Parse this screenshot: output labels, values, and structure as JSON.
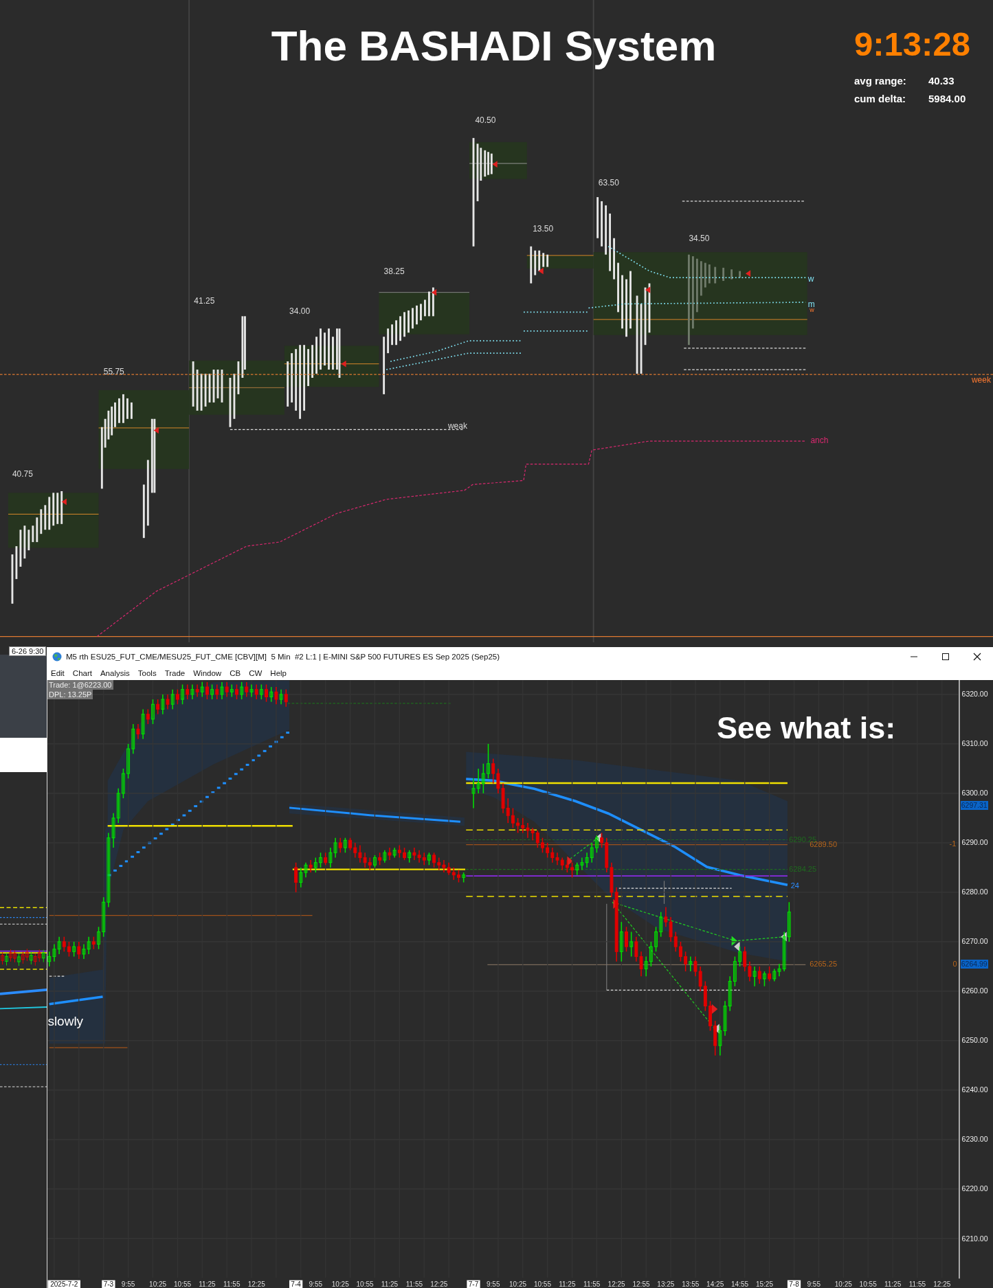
{
  "profile_chart": {
    "title": "The BASHADI System",
    "clock": "9:13:28",
    "stats": [
      {
        "label": "avg range:",
        "value": "40.33"
      },
      {
        "label": "cum delta:",
        "value": "5984.00"
      }
    ],
    "range_labels": [
      "40.50",
      "63.50",
      "13.50",
      "34.50",
      "38.25",
      "41.25",
      "34.00",
      "55.75",
      "40.75"
    ],
    "line_labels": [
      {
        "text": "w",
        "kind": "vwap"
      },
      {
        "text": "m",
        "kind": "vwap"
      },
      {
        "text": "w",
        "kind": "minor"
      },
      {
        "text": "week",
        "kind": "week"
      },
      {
        "text": "weak",
        "kind": "level"
      },
      {
        "text": "anch",
        "kind": "anchor"
      }
    ]
  },
  "left_panel": {
    "time_tab": "6-26 9:30"
  },
  "chart_window": {
    "title": "M5 rth ESU25_FUT_CME/MESU25_FUT_CME [CBV][M]  5 Min  #2 L:1 | E-MINI S&P 500 FUTURES ES Sep 2025 (Sep25)",
    "menu": [
      "Edit",
      "Chart",
      "Analysis",
      "Tools",
      "Trade",
      "Window",
      "CB",
      "CW",
      "Help"
    ],
    "trade_info": [
      "Trade: 1@6223.00",
      "DPL: 13.25P"
    ],
    "overlay_texts": [
      "See what is:",
      "slowly"
    ],
    "price_markers": [
      "6297.31",
      "6264.99"
    ],
    "axis_labels": [
      {
        "kind": "date"
      },
      {
        "kind": "date"
      },
      {
        "kind": "time"
      },
      {
        "kind": "time"
      },
      {
        "kind": "time"
      },
      {
        "kind": "time"
      },
      {
        "kind": "time"
      },
      {
        "kind": "time"
      },
      {
        "kind": "date"
      },
      {
        "kind": "time"
      },
      {
        "kind": "time"
      },
      {
        "kind": "time"
      },
      {
        "kind": "time"
      },
      {
        "kind": "time"
      },
      {
        "kind": "time"
      },
      {
        "kind": "date"
      },
      {
        "kind": "time"
      },
      {
        "kind": "time"
      },
      {
        "kind": "time"
      },
      {
        "kind": "time"
      },
      {
        "kind": "time"
      },
      {
        "kind": "time"
      },
      {
        "kind": "time"
      },
      {
        "kind": "time"
      },
      {
        "kind": "time"
      },
      {
        "kind": "time"
      },
      {
        "kind": "time"
      },
      {
        "kind": "time"
      },
      {
        "kind": "date"
      },
      {
        "kind": "time"
      },
      {
        "kind": "time"
      },
      {
        "kind": "time"
      },
      {
        "kind": "time"
      },
      {
        "kind": "time"
      },
      {
        "kind": "time"
      }
    ],
    "level_labels": [
      {
        "text": "6290.25",
        "color": "#1e6b1e"
      },
      {
        "text": "6289.50",
        "color": "#b8651a"
      },
      {
        "text": "6284.25",
        "color": "#1e6b1e"
      },
      {
        "text": "24",
        "color": "#2b8cff"
      },
      {
        "text": "6265.25",
        "color": "#b8651a"
      },
      {
        "text": "-1",
        "color": "#b8651a"
      },
      {
        "text": "0",
        "color": "#b8651a"
      }
    ],
    "chart_data": {
      "type": "candlestick",
      "grid": true,
      "ylim": [
        6201.9,
        6322.9
      ],
      "yticks": [
        {
          "value": 6320,
          "label": "6320.00"
        },
        {
          "value": 6310,
          "label": "6310.00"
        },
        {
          "value": 6300,
          "label": "6300.00"
        },
        {
          "value": 6290,
          "label": "6290.00"
        },
        {
          "value": 6280,
          "label": "6280.00"
        },
        {
          "value": 6270,
          "label": "6270.00"
        },
        {
          "value": 6260,
          "label": "6260.00"
        },
        {
          "value": 6250,
          "label": "6250.00"
        },
        {
          "value": 6240,
          "label": "6240.00"
        },
        {
          "value": 6230,
          "label": "6230.00"
        },
        {
          "value": 6220,
          "label": "6220.00"
        },
        {
          "value": 6210,
          "label": "6210.00"
        }
      ],
      "categories": [
        null,
        null,
        null,
        "2025-7-2",
        null,
        null,
        null,
        null,
        null,
        null,
        null,
        null,
        "7-3",
        null,
        null,
        null,
        "9:55",
        null,
        null,
        null,
        null,
        null,
        "10:25",
        null,
        null,
        null,
        null,
        "10:55",
        null,
        null,
        null,
        null,
        "11:25",
        null,
        null,
        null,
        null,
        "11:55",
        null,
        null,
        null,
        null,
        "12:25",
        null,
        null,
        null,
        null,
        null,
        null,
        null,
        "7-4",
        null,
        null,
        null,
        "9:55",
        null,
        null,
        null,
        null,
        "10:25",
        null,
        null,
        null,
        null,
        "10:55",
        null,
        null,
        null,
        null,
        "11:25",
        null,
        null,
        null,
        null,
        "11:55",
        null,
        null,
        null,
        null,
        "12:25",
        null,
        null,
        null,
        null,
        null,
        null,
        "7-7",
        null,
        null,
        null,
        "9:55",
        null,
        null,
        null,
        null,
        "10:25",
        null,
        null,
        null,
        null,
        "10:55",
        null,
        null,
        null,
        null,
        "11:25",
        null,
        null,
        null,
        null,
        "11:55",
        null,
        null,
        null,
        null,
        "12:25",
        null,
        null,
        null,
        null,
        "12:55",
        null,
        null,
        null,
        null,
        "13:25",
        null,
        null,
        null,
        null,
        "13:55",
        null,
        null,
        null,
        null,
        "14:25",
        null,
        null,
        null,
        null,
        "14:55",
        null,
        null,
        null,
        null,
        "15:25",
        null,
        null,
        null,
        null,
        null,
        "7-8",
        null,
        null,
        null,
        "9:55",
        null,
        null,
        null,
        null,
        null,
        "10:25",
        null,
        null,
        null,
        null,
        "10:55",
        null,
        null,
        null,
        null,
        "11:25",
        null,
        null,
        null,
        null,
        "11:55",
        null,
        null,
        null,
        null,
        "12:25"
      ],
      "ohlc": [
        [
          6266,
          6268,
          6265,
          6267
        ],
        [
          6267,
          6269.5,
          6266,
          6268.5
        ],
        [
          6268.5,
          6271,
          6267.5,
          6270
        ],
        [
          6270,
          6271,
          6268,
          6269
        ],
        [
          6269,
          6270,
          6267,
          6268
        ],
        [
          6268,
          6270,
          6267,
          6269
        ],
        [
          6269,
          6270,
          6266.5,
          6267.5
        ],
        [
          6267.5,
          6269.5,
          6266.5,
          6268.5
        ],
        [
          6268.5,
          6271,
          6267.5,
          6270
        ],
        [
          6270,
          6271,
          6268.5,
          6269.5
        ],
        [
          6269.5,
          6273,
          6268.5,
          6272
        ],
        [
          6272,
          6279,
          6271,
          6278
        ],
        [
          6278,
          6292,
          6277,
          6291
        ],
        [
          6291,
          6296,
          6289,
          6295
        ],
        [
          6295,
          6301,
          6294,
          6300
        ],
        [
          6300,
          6305,
          6299,
          6304
        ],
        [
          6304,
          6310,
          6303,
          6309
        ],
        [
          6309,
          6314,
          6308,
          6313
        ],
        [
          6313,
          6314,
          6311,
          6312
        ],
        [
          6312,
          6317,
          6311,
          6316
        ],
        [
          6316,
          6317,
          6314,
          6315
        ],
        [
          6315,
          6319,
          6314,
          6318
        ],
        [
          6318,
          6319,
          6316,
          6317
        ],
        [
          6317,
          6320,
          6316,
          6319
        ],
        [
          6319,
          6320,
          6317,
          6318
        ],
        [
          6318,
          6321,
          6317,
          6320
        ],
        [
          6320,
          6321,
          6318,
          6319
        ],
        [
          6319,
          6322,
          6318,
          6321
        ],
        [
          6321,
          6322,
          6319,
          6320
        ],
        [
          6320,
          6322,
          6319,
          6321
        ],
        [
          6321,
          6322,
          6319.5,
          6320.5
        ],
        [
          6320.5,
          6322.5,
          6319.5,
          6321.5
        ],
        [
          6321.5,
          6322.5,
          6319,
          6320
        ],
        [
          6320,
          6322,
          6319,
          6321
        ],
        [
          6321,
          6322,
          6319,
          6320
        ],
        [
          6320,
          6322.5,
          6319,
          6321.5
        ],
        [
          6321.5,
          6322.5,
          6319.5,
          6320.5
        ],
        [
          6320.5,
          6322,
          6319.5,
          6321
        ],
        [
          6321,
          6322,
          6319,
          6320
        ],
        [
          6320,
          6322.5,
          6319,
          6321.5
        ],
        [
          6321.5,
          6322.5,
          6319.5,
          6320.5
        ],
        [
          6320.5,
          6322,
          6319.5,
          6321
        ],
        [
          6321,
          6322,
          6319,
          6320
        ],
        [
          6320,
          6322,
          6319,
          6321
        ],
        [
          6321,
          6322,
          6318.5,
          6319.5
        ],
        [
          6319.5,
          6321.5,
          6318.5,
          6320.5
        ],
        [
          6320.5,
          6321.5,
          6318,
          6319
        ],
        [
          6319,
          6321,
          6318,
          6320
        ],
        [
          6320,
          6321,
          6317.5,
          6318.5
        ],
        null,
        [
          6285,
          6286,
          6280,
          6282
        ],
        [
          6282,
          6285,
          6281,
          6284
        ],
        [
          6284,
          6286,
          6283,
          6285.5
        ],
        [
          6285.5,
          6286.5,
          6284,
          6285
        ],
        [
          6285,
          6287,
          6284,
          6286
        ],
        [
          6286,
          6288,
          6285,
          6287
        ],
        [
          6287,
          6288,
          6285.5,
          6286
        ],
        [
          6286,
          6289,
          6285,
          6288
        ],
        [
          6288,
          6291,
          6287,
          6290
        ],
        [
          6290,
          6291,
          6288,
          6289
        ],
        [
          6289,
          6291,
          6288,
          6290.5
        ],
        [
          6290.5,
          6291,
          6288.5,
          6289
        ],
        [
          6289,
          6290,
          6287,
          6288
        ],
        [
          6288,
          6289.5,
          6286,
          6287
        ],
        [
          6287,
          6288,
          6285,
          6286
        ],
        [
          6286,
          6287,
          6284.5,
          6285.5
        ],
        [
          6285.5,
          6287.5,
          6285,
          6287
        ],
        [
          6287,
          6288,
          6285.5,
          6286.5
        ],
        [
          6286.5,
          6288.5,
          6286,
          6288
        ],
        [
          6288,
          6289,
          6286.5,
          6287.5
        ],
        [
          6287.5,
          6289,
          6287,
          6288.5
        ],
        [
          6288.5,
          6289.5,
          6287,
          6288
        ],
        [
          6288,
          6289,
          6286.5,
          6287
        ],
        [
          6287,
          6288.5,
          6286,
          6288
        ],
        [
          6288,
          6289,
          6286.5,
          6287.5
        ],
        [
          6287.5,
          6288.5,
          6286,
          6287
        ],
        [
          6287,
          6288,
          6285.5,
          6286.5
        ],
        [
          6286.5,
          6288,
          6285.5,
          6287.5
        ],
        [
          6287.5,
          6288,
          6285,
          6286
        ],
        [
          6286,
          6287,
          6284.5,
          6285.5
        ],
        [
          6285.5,
          6286.5,
          6284,
          6285
        ],
        [
          6285,
          6286,
          6283.5,
          6284
        ],
        [
          6284,
          6285,
          6282.5,
          6283.5
        ],
        [
          6283.5,
          6284.5,
          6282,
          6283
        ],
        [
          6283,
          6284,
          6282,
          6283.5
        ],
        null,
        [
          6300,
          6303,
          6297,
          6301
        ],
        [
          6301,
          6305,
          6300,
          6302
        ],
        [
          6302,
          6306,
          6300,
          6304
        ],
        [
          6304,
          6310,
          6303,
          6306
        ],
        [
          6306,
          6307,
          6302,
          6304
        ],
        [
          6304,
          6305,
          6300,
          6301
        ],
        [
          6301,
          6302,
          6296,
          6297
        ],
        [
          6297,
          6299,
          6294,
          6295.5
        ],
        [
          6295.5,
          6297,
          6293,
          6294
        ],
        [
          6294,
          6295,
          6292,
          6293.5
        ],
        [
          6293.5,
          6295,
          6292,
          6293
        ],
        [
          6293,
          6294,
          6291,
          6292.5
        ],
        [
          6292.5,
          6293,
          6290.5,
          6292
        ],
        [
          6292,
          6292.5,
          6289,
          6290
        ],
        [
          6290,
          6291,
          6288,
          6289
        ],
        [
          6289,
          6290,
          6287,
          6288
        ],
        [
          6288,
          6289,
          6286,
          6287
        ],
        [
          6287,
          6288,
          6285.5,
          6286.5
        ],
        [
          6286.5,
          6287,
          6284.5,
          6285.5
        ],
        [
          6285.5,
          6286.5,
          6284,
          6285
        ],
        [
          6285,
          6286,
          6283,
          6284.5
        ],
        [
          6284.5,
          6286,
          6283.5,
          6285.5
        ],
        [
          6285.5,
          6287,
          6284.5,
          6286
        ],
        [
          6286,
          6288,
          6285,
          6287
        ],
        [
          6287,
          6290,
          6286,
          6289
        ],
        [
          6289,
          6291.5,
          6288,
          6291
        ],
        [
          6291,
          6292,
          6289,
          6290
        ],
        [
          6290,
          6291,
          6284,
          6285
        ],
        [
          6285,
          6286,
          6279,
          6280
        ],
        [
          6280,
          6281,
          6266,
          6268
        ],
        [
          6268,
          6274,
          6266,
          6272
        ],
        [
          6272,
          6273,
          6268,
          6269
        ],
        [
          6269,
          6272,
          6267,
          6270
        ],
        [
          6270,
          6271,
          6266,
          6267
        ],
        [
          6267,
          6268,
          6263,
          6264.5
        ],
        [
          6264.5,
          6267,
          6263,
          6266
        ],
        [
          6266,
          6270,
          6265,
          6269
        ],
        [
          6269,
          6273,
          6268,
          6272
        ],
        [
          6272,
          6276,
          6271,
          6275
        ],
        [
          6275,
          6277,
          6273,
          6274
        ],
        [
          6274,
          6275,
          6270,
          6271
        ],
        [
          6271,
          6272,
          6268,
          6269
        ],
        [
          6269,
          6270,
          6266,
          6267
        ],
        [
          6267,
          6268,
          6264,
          6265.5
        ],
        [
          6265.5,
          6267,
          6264,
          6266
        ],
        [
          6266,
          6267,
          6263,
          6264
        ],
        [
          6264,
          6265,
          6260,
          6261
        ],
        [
          6261,
          6262,
          6256,
          6257
        ],
        [
          6257,
          6258,
          6252,
          6253
        ],
        [
          6253,
          6254,
          6247,
          6249
        ],
        [
          6249,
          6253,
          6247,
          6252
        ],
        [
          6252,
          6258,
          6251,
          6257
        ],
        [
          6257,
          6263,
          6256,
          6262
        ],
        [
          6262,
          6267,
          6261,
          6266
        ],
        [
          6266,
          6269,
          6265,
          6268
        ],
        [
          6268,
          6269,
          6264,
          6265
        ],
        [
          6265,
          6266,
          6262,
          6263
        ],
        [
          6263,
          6265,
          6261,
          6264
        ],
        [
          6264,
          6265,
          6261.5,
          6262.5
        ],
        [
          6262.5,
          6264,
          6261,
          6263.5
        ],
        [
          6263.5,
          6265,
          6262,
          6262.5
        ],
        [
          6262.5,
          6264.5,
          6262,
          6264
        ],
        [
          6264,
          6265.5,
          6263,
          6264.5
        ],
        [
          6264.5,
          6272,
          6264,
          6271
        ],
        [
          6271,
          6278,
          6270,
          6276
        ],
        null,
        null,
        null,
        null,
        null,
        null,
        null,
        null,
        null,
        null,
        null,
        null,
        null,
        null,
        null,
        null,
        null,
        null,
        null,
        null,
        null,
        null,
        null,
        null,
        null,
        null,
        null,
        null,
        null,
        null,
        null
      ]
    }
  }
}
